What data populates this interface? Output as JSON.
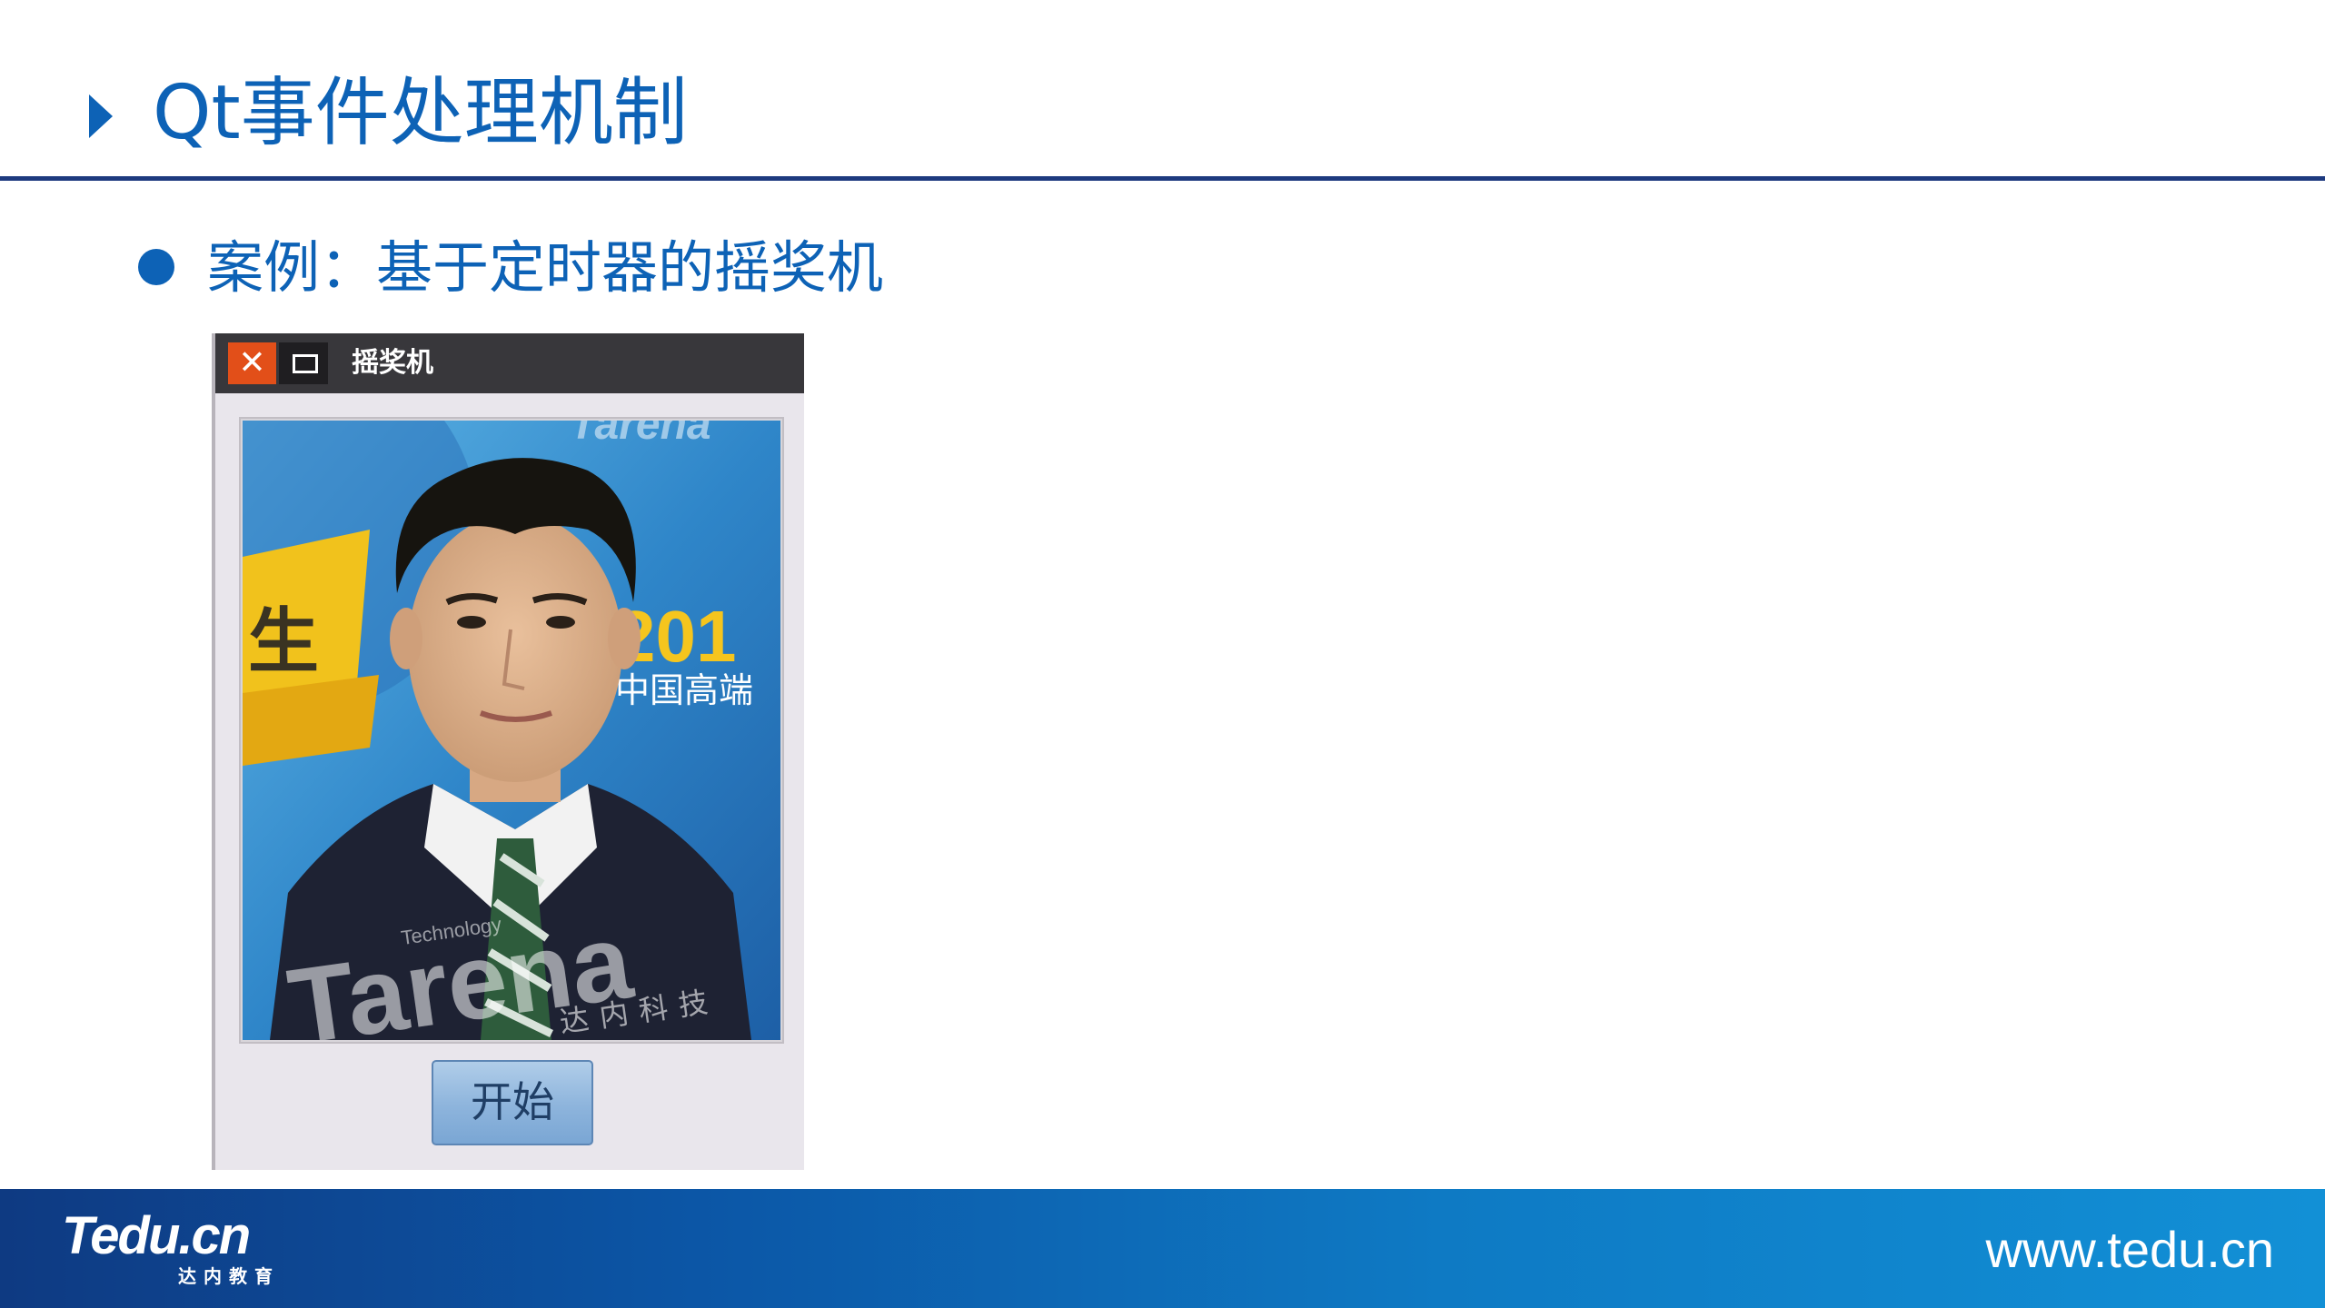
{
  "slide": {
    "title": "Qt事件处理机制",
    "bullet": "案例：基于定时器的摇奖机"
  },
  "app_window": {
    "title": "摇奖机",
    "close_glyph": "✕",
    "photo_texts": {
      "brand_top": "Tarena",
      "year": "201",
      "chinese_banner": "中国高端",
      "char_left": "生",
      "brand_watermark": "Tarena",
      "brand_sub": "Technology",
      "brand_cn": "达内科技"
    },
    "start_button_label": "开始"
  },
  "footer": {
    "logo": "Tedu.cn",
    "logo_sub": "达内教育",
    "url": "www.tedu.cn"
  },
  "colors": {
    "accent": "#0d62b6",
    "rule": "#1d3a7f",
    "close": "#e24f19",
    "footer_dark": "#0e3a82",
    "footer_light": "#1290d6"
  },
  "icons": [
    "triangle-right-icon",
    "bullet-dot-icon",
    "close-icon",
    "maximize-icon"
  ]
}
